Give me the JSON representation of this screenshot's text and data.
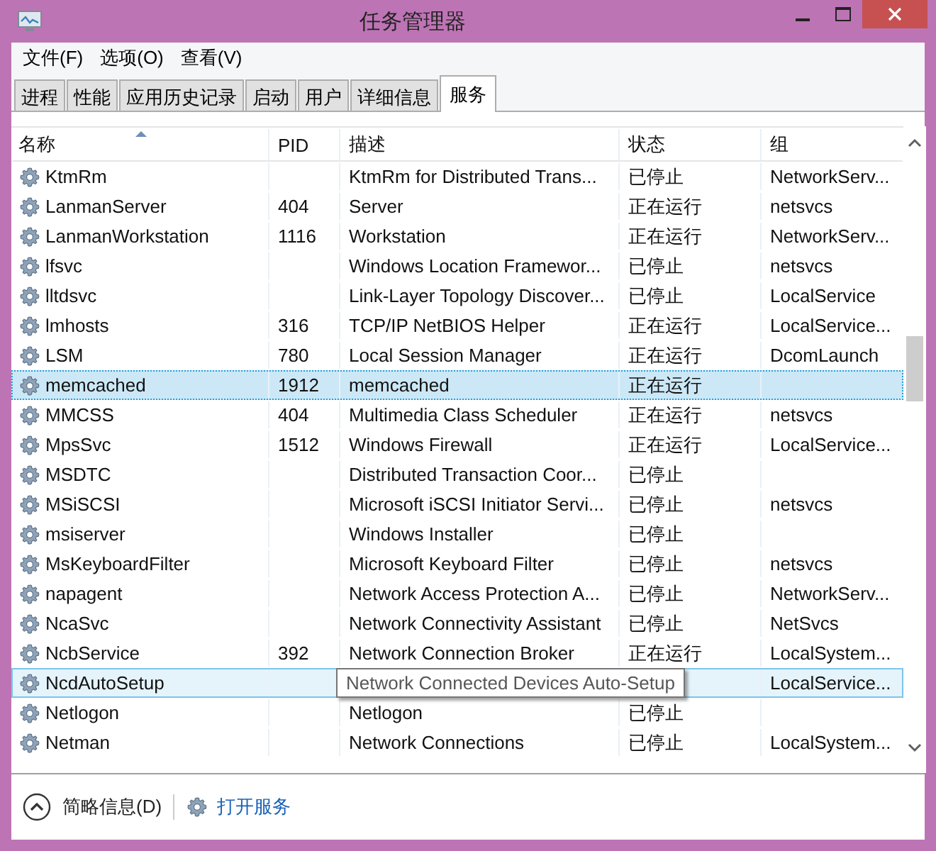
{
  "window": {
    "title": "任务管理器"
  },
  "menu": [
    "文件(F)",
    "选项(O)",
    "查看(V)"
  ],
  "tabs": [
    {
      "label": "进程",
      "selected": false
    },
    {
      "label": "性能",
      "selected": false
    },
    {
      "label": "应用历史记录",
      "selected": false
    },
    {
      "label": "启动",
      "selected": false
    },
    {
      "label": "用户",
      "selected": false
    },
    {
      "label": "详细信息",
      "selected": false
    },
    {
      "label": "服务",
      "selected": true
    }
  ],
  "table": {
    "columns": [
      {
        "label": "名称",
        "sorted": true
      },
      {
        "label": "PID",
        "sorted": false
      },
      {
        "label": "描述",
        "sorted": false
      },
      {
        "label": "状态",
        "sorted": false
      },
      {
        "label": "组",
        "sorted": false
      }
    ],
    "rows": [
      {
        "name": "KtmRm",
        "pid": "",
        "description": "KtmRm for Distributed Trans...",
        "status": "已停止",
        "group": "NetworkServ...",
        "selected": false,
        "hovered": false
      },
      {
        "name": "LanmanServer",
        "pid": "404",
        "description": "Server",
        "status": "正在运行",
        "group": "netsvcs",
        "selected": false,
        "hovered": false
      },
      {
        "name": "LanmanWorkstation",
        "pid": "1116",
        "description": "Workstation",
        "status": "正在运行",
        "group": "NetworkServ...",
        "selected": false,
        "hovered": false
      },
      {
        "name": "lfsvc",
        "pid": "",
        "description": "Windows Location Framewor...",
        "status": "已停止",
        "group": "netsvcs",
        "selected": false,
        "hovered": false
      },
      {
        "name": "lltdsvc",
        "pid": "",
        "description": "Link-Layer Topology Discover...",
        "status": "已停止",
        "group": "LocalService",
        "selected": false,
        "hovered": false
      },
      {
        "name": "lmhosts",
        "pid": "316",
        "description": "TCP/IP NetBIOS Helper",
        "status": "正在运行",
        "group": "LocalService...",
        "selected": false,
        "hovered": false
      },
      {
        "name": "LSM",
        "pid": "780",
        "description": "Local Session Manager",
        "status": "正在运行",
        "group": "DcomLaunch",
        "selected": false,
        "hovered": false
      },
      {
        "name": "memcached",
        "pid": "1912",
        "description": "memcached",
        "status": "正在运行",
        "group": "",
        "selected": true,
        "hovered": false
      },
      {
        "name": "MMCSS",
        "pid": "404",
        "description": "Multimedia Class Scheduler",
        "status": "正在运行",
        "group": "netsvcs",
        "selected": false,
        "hovered": false
      },
      {
        "name": "MpsSvc",
        "pid": "1512",
        "description": "Windows Firewall",
        "status": "正在运行",
        "group": "LocalService...",
        "selected": false,
        "hovered": false
      },
      {
        "name": "MSDTC",
        "pid": "",
        "description": "Distributed Transaction Coor...",
        "status": "已停止",
        "group": "",
        "selected": false,
        "hovered": false
      },
      {
        "name": "MSiSCSI",
        "pid": "",
        "description": "Microsoft iSCSI Initiator Servi...",
        "status": "已停止",
        "group": "netsvcs",
        "selected": false,
        "hovered": false
      },
      {
        "name": "msiserver",
        "pid": "",
        "description": "Windows Installer",
        "status": "已停止",
        "group": "",
        "selected": false,
        "hovered": false
      },
      {
        "name": "MsKeyboardFilter",
        "pid": "",
        "description": "Microsoft Keyboard Filter",
        "status": "已停止",
        "group": "netsvcs",
        "selected": false,
        "hovered": false
      },
      {
        "name": "napagent",
        "pid": "",
        "description": "Network Access Protection A...",
        "status": "已停止",
        "group": "NetworkServ...",
        "selected": false,
        "hovered": false
      },
      {
        "name": "NcaSvc",
        "pid": "",
        "description": "Network Connectivity Assistant",
        "status": "已停止",
        "group": "NetSvcs",
        "selected": false,
        "hovered": false
      },
      {
        "name": "NcbService",
        "pid": "392",
        "description": "Network Connection Broker",
        "status": "正在运行",
        "group": "LocalSystem...",
        "selected": false,
        "hovered": false
      },
      {
        "name": "NcdAutoSetup",
        "pid": "",
        "description": "",
        "status": "",
        "group": "LocalService...",
        "selected": false,
        "hovered": true,
        "tooltip": "Network Connected Devices Auto-Setup"
      },
      {
        "name": "Netlogon",
        "pid": "",
        "description": "Netlogon",
        "status": "已停止",
        "group": "",
        "selected": false,
        "hovered": false
      },
      {
        "name": "Netman",
        "pid": "",
        "description": "Network Connections",
        "status": "已停止",
        "group": "LocalSystem...",
        "selected": false,
        "hovered": false
      }
    ]
  },
  "footer": {
    "details_toggle": "简略信息(D)",
    "open_services": "打开服务"
  }
}
